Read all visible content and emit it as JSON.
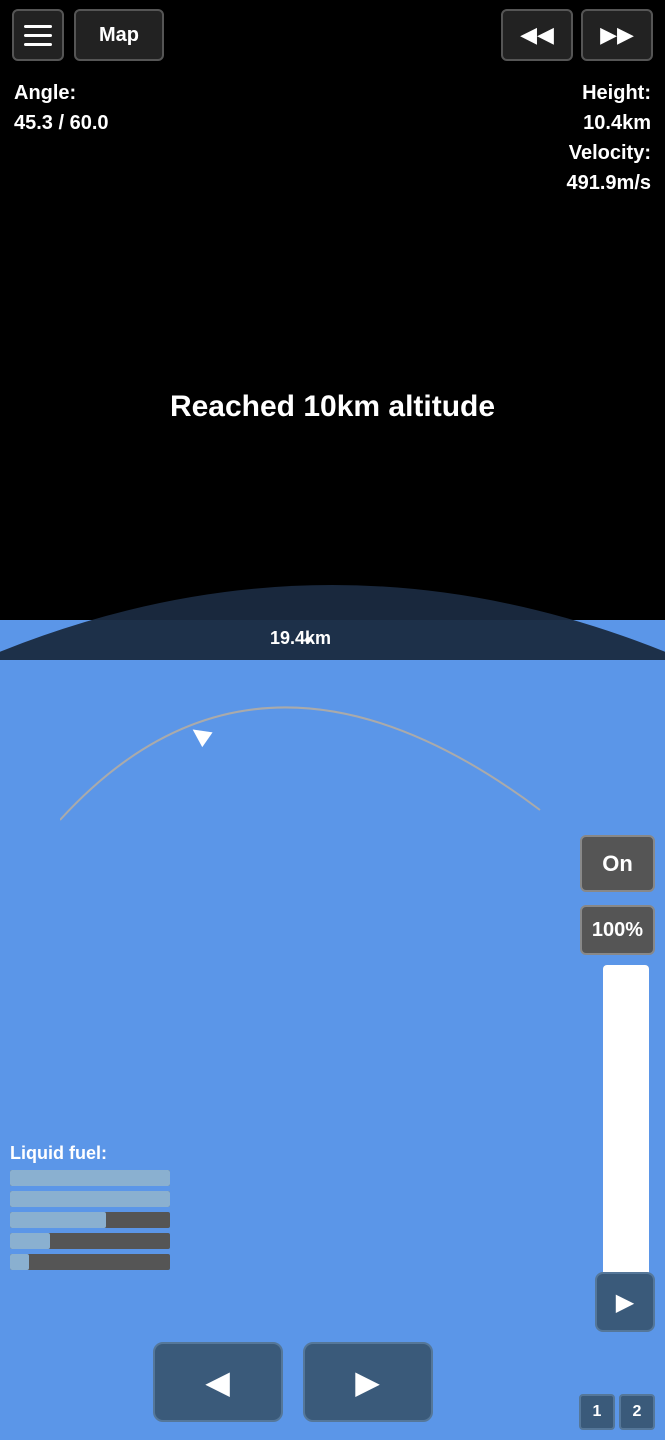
{
  "header": {
    "menu_label": "☰",
    "map_label": "Map",
    "rewind_label": "◀◀",
    "forward_label": "▶▶"
  },
  "stats": {
    "angle_label": "Angle:",
    "angle_value": "45.3 / 60.0",
    "height_label": "Height:",
    "height_value": "10.4km",
    "velocity_label": "Velocity:",
    "velocity_value": "491.9m/s"
  },
  "main": {
    "altitude_message": "Reached 10km altitude",
    "distance_label": "19.4km"
  },
  "controls": {
    "on_label": "On",
    "percent_label": "100%",
    "slider_fill_percent": 100
  },
  "fuel": {
    "label": "Liquid fuel:",
    "bars": [
      {
        "fill": 100
      },
      {
        "fill": 100
      },
      {
        "fill": 60
      },
      {
        "fill": 25
      },
      {
        "fill": 12
      }
    ]
  },
  "bottom_nav": {
    "rewind_label": "◀",
    "play_label": "▶"
  },
  "side_buttons": {
    "play_label": "▶",
    "num1_label": "1",
    "num2_label": "2"
  }
}
